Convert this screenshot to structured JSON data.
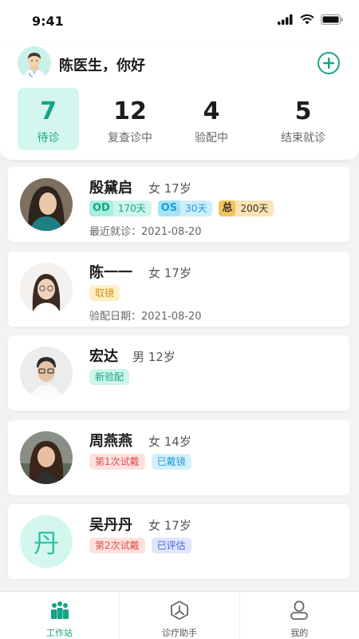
{
  "status_bar": {
    "time": "9:41"
  },
  "header": {
    "greeting": "陈医生，你好",
    "stats": [
      {
        "num": "7",
        "label": "待诊"
      },
      {
        "num": "12",
        "label": "复查诊中"
      },
      {
        "num": "4",
        "label": "验配中"
      },
      {
        "num": "5",
        "label": "结束就诊"
      }
    ]
  },
  "patients": [
    {
      "name": "殷黛启",
      "meta": "女 17岁",
      "od_key": "OD",
      "od_val": "170天",
      "os_key": "OS",
      "os_val": "30天",
      "total_key": "总",
      "total_val": "200天",
      "sub": "最近就诊：2021-08-20"
    },
    {
      "name": "陈一一",
      "meta": "女 17岁",
      "tag": "取镜",
      "sub": "验配日期：2021-08-20"
    },
    {
      "name": "宏达",
      "meta": "男 12岁",
      "tag": "新验配"
    },
    {
      "name": "周燕燕",
      "meta": "女 14岁",
      "tag1": "第1次试戴",
      "tag2": "已戴镜"
    },
    {
      "name": "吴丹丹",
      "meta": "女 17岁",
      "avatar_letter": "丹",
      "tag1": "第2次试戴",
      "tag2": "已评估"
    }
  ],
  "tabbar": {
    "tabs": [
      {
        "label": "工作站",
        "icon": "workstation-icon"
      },
      {
        "label": "诊疗助手",
        "icon": "assistant-icon"
      },
      {
        "label": "我的",
        "icon": "profile-icon"
      }
    ]
  },
  "colors": {
    "accent": "#17a387",
    "background": "#f2f3f5"
  }
}
